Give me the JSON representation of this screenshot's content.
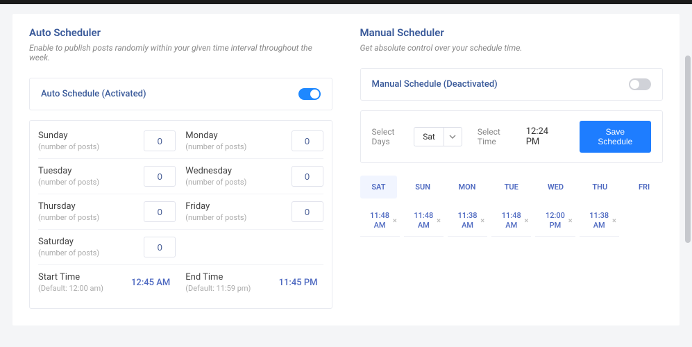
{
  "auto": {
    "title": "Auto Scheduler",
    "subtitle": "Enable to publish posts randomly within your given time interval throughout the week.",
    "card_label": "Auto Schedule (Activated)",
    "toggle_on": true,
    "days": [
      {
        "name": "Sunday",
        "hint": "(number of posts)",
        "value": "0"
      },
      {
        "name": "Monday",
        "hint": "(number of posts)",
        "value": "0"
      },
      {
        "name": "Tuesday",
        "hint": "(number of posts)",
        "value": "0"
      },
      {
        "name": "Wednesday",
        "hint": "(number of posts)",
        "value": "0"
      },
      {
        "name": "Thursday",
        "hint": "(number of posts)",
        "value": "0"
      },
      {
        "name": "Friday",
        "hint": "(number of posts)",
        "value": "0"
      },
      {
        "name": "Saturday",
        "hint": "(number of posts)",
        "value": "0"
      }
    ],
    "start": {
      "name": "Start Time",
      "hint": "(Default: 12:00 am)",
      "value": "12:45 AM"
    },
    "end": {
      "name": "End Time",
      "hint": "(Default: 11:59 pm)",
      "value": "11:45 PM"
    }
  },
  "manual": {
    "title": "Manual Scheduler",
    "subtitle": "Get absolute control over your schedule time.",
    "card_label": "Manual Schedule (Deactivated)",
    "toggle_on": false,
    "select_days_label": "Select Days",
    "select_days_value": "Sat",
    "select_time_label": "Select Time",
    "select_time_value": "12:24 PM",
    "save_button": "Save Schedule",
    "tabs": [
      "SAT",
      "SUN",
      "MON",
      "TUE",
      "WED",
      "THU",
      "FRI"
    ],
    "tabs_active_index": 0,
    "times": [
      "11:48\nAM",
      "11:48\nAM",
      "11:38\nAM",
      "11:48\nAM",
      "12:00\nPM",
      "11:38\nAM"
    ]
  }
}
